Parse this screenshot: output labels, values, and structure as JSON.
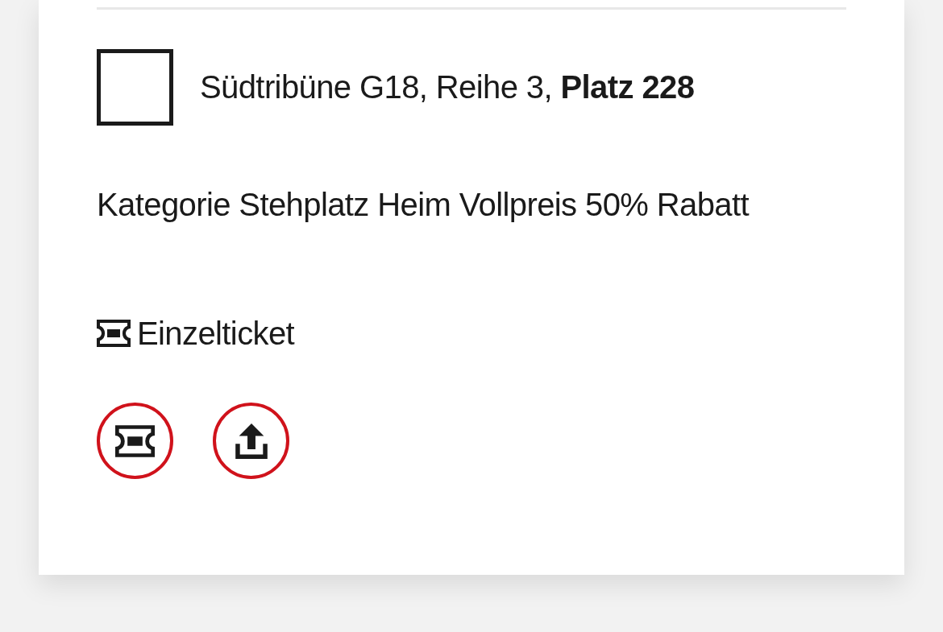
{
  "seat": {
    "checked": false,
    "label": "Südtribüne G18, Reihe 3, **Platz 228**"
  },
  "category": "Kategorie Stehplatz Heim Vollpreis 50% Rabatt",
  "ticket_type": {
    "kind": "single",
    "label": "Einzelticket"
  },
  "actions": [
    {
      "kind": "ticket"
    },
    {
      "kind": "share"
    }
  ]
}
